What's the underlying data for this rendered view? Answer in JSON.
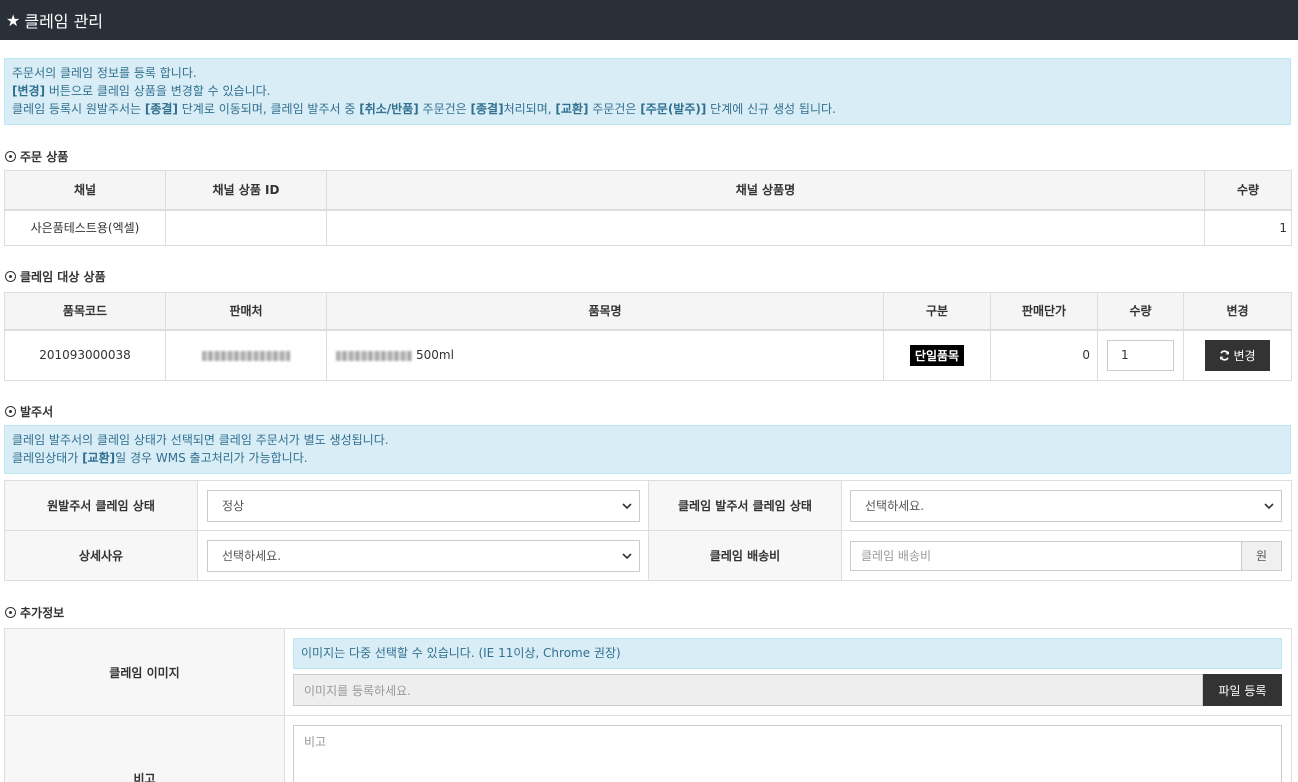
{
  "header": {
    "title": "클레임 관리"
  },
  "notice_top": {
    "line1": "주문서의 클레임 정보를 등록 합니다.",
    "line2_bold": "[변경]",
    "line2_rest": " 버튼으로 클레임 상품을 변경할 수 있습니다.",
    "line3": [
      {
        "t": "클레임 등록시 원발주서는 ",
        "b": false
      },
      {
        "t": "[종결]",
        "b": true
      },
      {
        "t": " 단계로 이동되며, 클레임 발주서 중 ",
        "b": false
      },
      {
        "t": "[취소/반품]",
        "b": true
      },
      {
        "t": " 주문건은 ",
        "b": false
      },
      {
        "t": "[종결]",
        "b": true
      },
      {
        "t": "처리되며, ",
        "b": false
      },
      {
        "t": "[교환]",
        "b": true
      },
      {
        "t": " 주문건은 ",
        "b": false
      },
      {
        "t": "[주문(발주)]",
        "b": true
      },
      {
        "t": " 단계에 신규 생성 됩니다.",
        "b": false
      }
    ]
  },
  "order_products": {
    "section_title": "주문 상품",
    "columns": [
      "채널",
      "채널 상품 ID",
      "채널 상품명",
      "수량"
    ],
    "row": {
      "channel": "사은품테스트용(엑셀)",
      "product_id": "",
      "product_name": "",
      "quantity": "1"
    }
  },
  "claim_products": {
    "section_title": "클레임 대상 상품",
    "columns": [
      "품목코드",
      "판매처",
      "품목명",
      "구분",
      "판매단가",
      "수량",
      "변경"
    ],
    "row": {
      "item_code": "201093000038",
      "item_name_suffix": "500ml",
      "type_badge": "단일품목",
      "unit_price": "0",
      "quantity_value": "1",
      "change_button": "변경"
    }
  },
  "purchase_order": {
    "section_title": "발주서",
    "notice_line1": "클레임 발주서의 클레임 상태가 선택되면 클레임 주문서가 별도 생성됩니다.",
    "notice_line2_pre": "클레임상태가 ",
    "notice_line2_bold": "[교환]",
    "notice_line2_post": "일 경우 WMS 출고처리가 가능합니다.",
    "orig_status_label": "원발주서 클레임 상태",
    "orig_status_value": "정상",
    "claim_status_label": "클레임 발주서 클레임 상태",
    "claim_status_value": "선택하세요.",
    "detail_reason_label": "상세사유",
    "detail_reason_value": "선택하세요.",
    "shipping_fee_label": "클레임 배송비",
    "shipping_fee_placeholder": "클레임 배송비",
    "shipping_fee_unit": "원"
  },
  "extra_info": {
    "section_title": "추가정보",
    "image_label": "클레임 이미지",
    "image_notice": "이미지는 다중 선택할 수 있습니다. (IE 11이상, Chrome 권장)",
    "image_placeholder": "이미지를 등록하세요.",
    "file_button": "파일 등록",
    "memo_label": "비고",
    "memo_placeholder": "비고"
  }
}
